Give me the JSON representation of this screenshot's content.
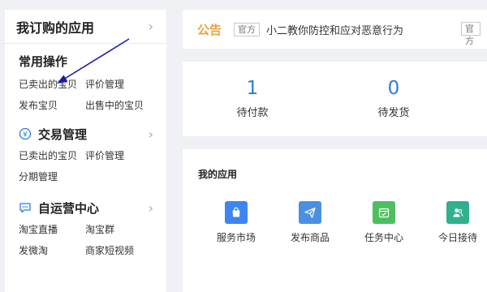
{
  "sidebar": {
    "title": "我订购的应用",
    "common": {
      "title": "常用操作",
      "links": [
        "已卖出的宝贝",
        "评价管理",
        "发布宝贝",
        "出售中的宝贝"
      ]
    },
    "trade": {
      "title": "交易管理",
      "icon": "yen-circle-icon",
      "links": [
        "已卖出的宝贝",
        "评价管理",
        "分期管理"
      ]
    },
    "ops": {
      "title": "自运营中心",
      "icon": "chat-bubble-icon",
      "links": [
        "淘宝直播",
        "淘宝群",
        "发微淘",
        "商家短视频"
      ]
    }
  },
  "notice": {
    "label": "公告",
    "tag": "官方",
    "text": "小二教你防控和应对恶意行为",
    "tag2": "官方"
  },
  "stats": [
    {
      "value": "1",
      "label": "待付款"
    },
    {
      "value": "0",
      "label": "待发货"
    }
  ],
  "apps": {
    "title": "我的应用",
    "items": [
      {
        "label": "服务市场",
        "icon": "shopping-bag-icon",
        "color": "#3d85f0"
      },
      {
        "label": "发布商品",
        "icon": "paper-plane-icon",
        "color": "#4a90e2"
      },
      {
        "label": "任务中心",
        "icon": "calendar-icon",
        "color": "#4cbf5f"
      },
      {
        "label": "今日接待",
        "icon": "users-icon",
        "color": "#2fb08f"
      }
    ]
  },
  "colors": {
    "accent": "#2e7bd9",
    "notice": "#e8a33a",
    "annotation_arrow": "#1a1aa6"
  }
}
